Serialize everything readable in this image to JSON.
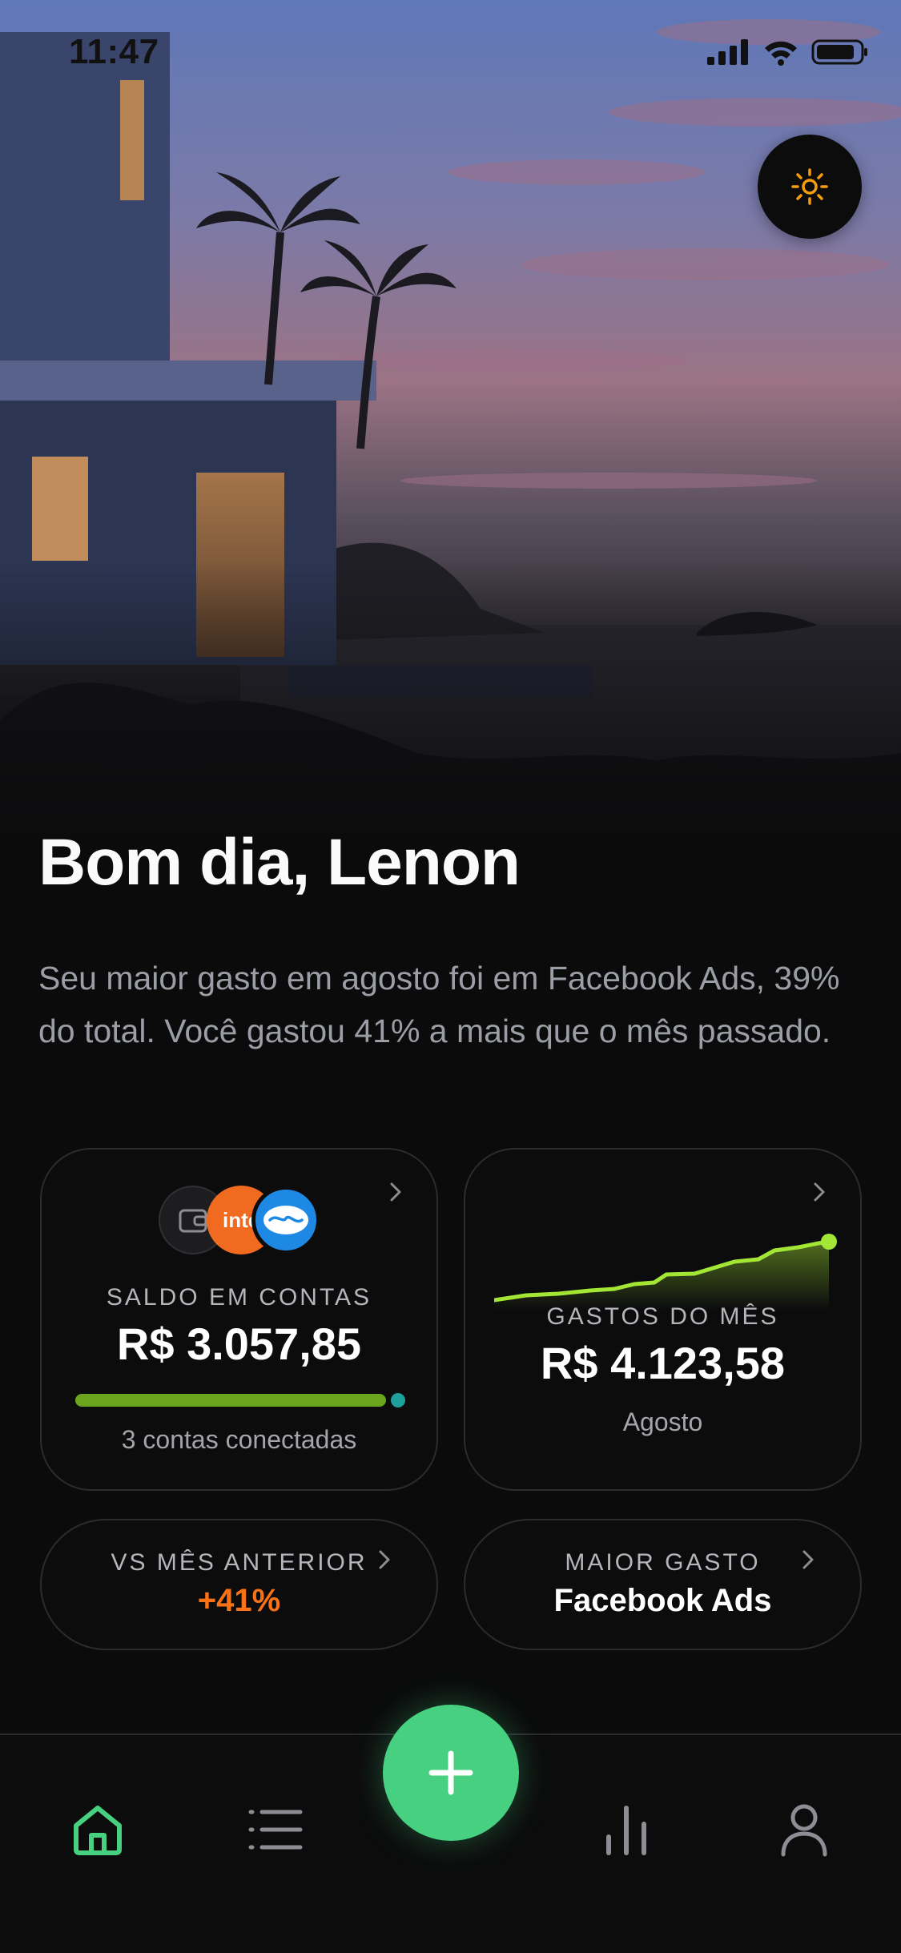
{
  "status_bar": {
    "time": "11:47"
  },
  "greeting": "Bom dia, Lenon",
  "summary": "Seu maior gasto em agosto foi em Facebook Ads, 39% do total. Você gastou 41% a mais que o mês passado.",
  "cards": {
    "balance": {
      "label": "SALDO EM CONTAS",
      "value": "R$ 3.057,85",
      "sub": "3 contas conectadas",
      "progress": 0.97,
      "logos": [
        "wallet-icon",
        "inter-logo",
        "mercado-pago-logo"
      ],
      "logo_text": "inte"
    },
    "spending": {
      "label": "GASTOS DO MÊS",
      "value": "R$ 4.123,58",
      "sub": "Agosto",
      "accent": "#a3e635"
    },
    "vs_previous": {
      "label": "VS MÊS ANTERIOR",
      "value": "+41%",
      "accent": "#f97316"
    },
    "top_expense": {
      "label": "MAIOR GASTO",
      "value": "Facebook Ads"
    }
  },
  "nav": {
    "items": [
      "home-icon",
      "list-icon",
      "add-button",
      "chart-icon",
      "profile-icon"
    ],
    "active": "home-icon",
    "accent": "#46d07f"
  },
  "colors": {
    "background": "#0b0b0c",
    "card_border": "#2b2c30",
    "muted": "#9b9ea5"
  }
}
